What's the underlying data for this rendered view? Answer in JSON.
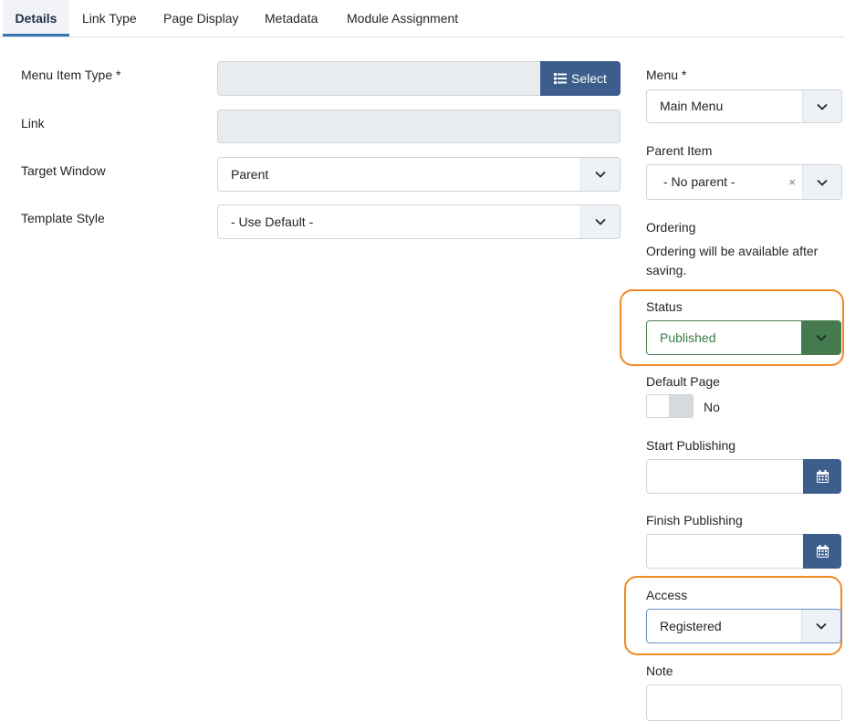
{
  "tabs": [
    {
      "label": "Details",
      "active": true
    },
    {
      "label": "Link Type"
    },
    {
      "label": "Page Display"
    },
    {
      "label": "Metadata"
    },
    {
      "label": "Module Assignment"
    }
  ],
  "left": {
    "menu_item_type": {
      "label": "Menu Item Type *",
      "value": "",
      "button": "Select",
      "button_icon": "list-icon"
    },
    "link": {
      "label": "Link",
      "value": ""
    },
    "target_window": {
      "label": "Target Window",
      "value": "Parent"
    },
    "template_style": {
      "label": "Template Style",
      "value": "- Use Default -"
    }
  },
  "right": {
    "menu": {
      "label": "Menu *",
      "value": "Main Menu"
    },
    "parent_item": {
      "label": "Parent Item",
      "value": "- No parent -",
      "clear": "×"
    },
    "ordering": {
      "label": "Ordering",
      "text": "Ordering will be available after saving."
    },
    "status": {
      "label": "Status",
      "value": "Published",
      "color": "#457a4f"
    },
    "default_page": {
      "label": "Default Page",
      "value": "No"
    },
    "start_publishing": {
      "label": "Start Publishing",
      "value": "",
      "icon": "calendar-icon"
    },
    "finish_publishing": {
      "label": "Finish Publishing",
      "value": "",
      "icon": "calendar-icon"
    },
    "access": {
      "label": "Access",
      "value": "Registered"
    },
    "note": {
      "label": "Note",
      "value": ""
    }
  },
  "colors": {
    "accent": "#3d5e8c",
    "highlight": "#f08a24",
    "published": "#457a4f"
  }
}
